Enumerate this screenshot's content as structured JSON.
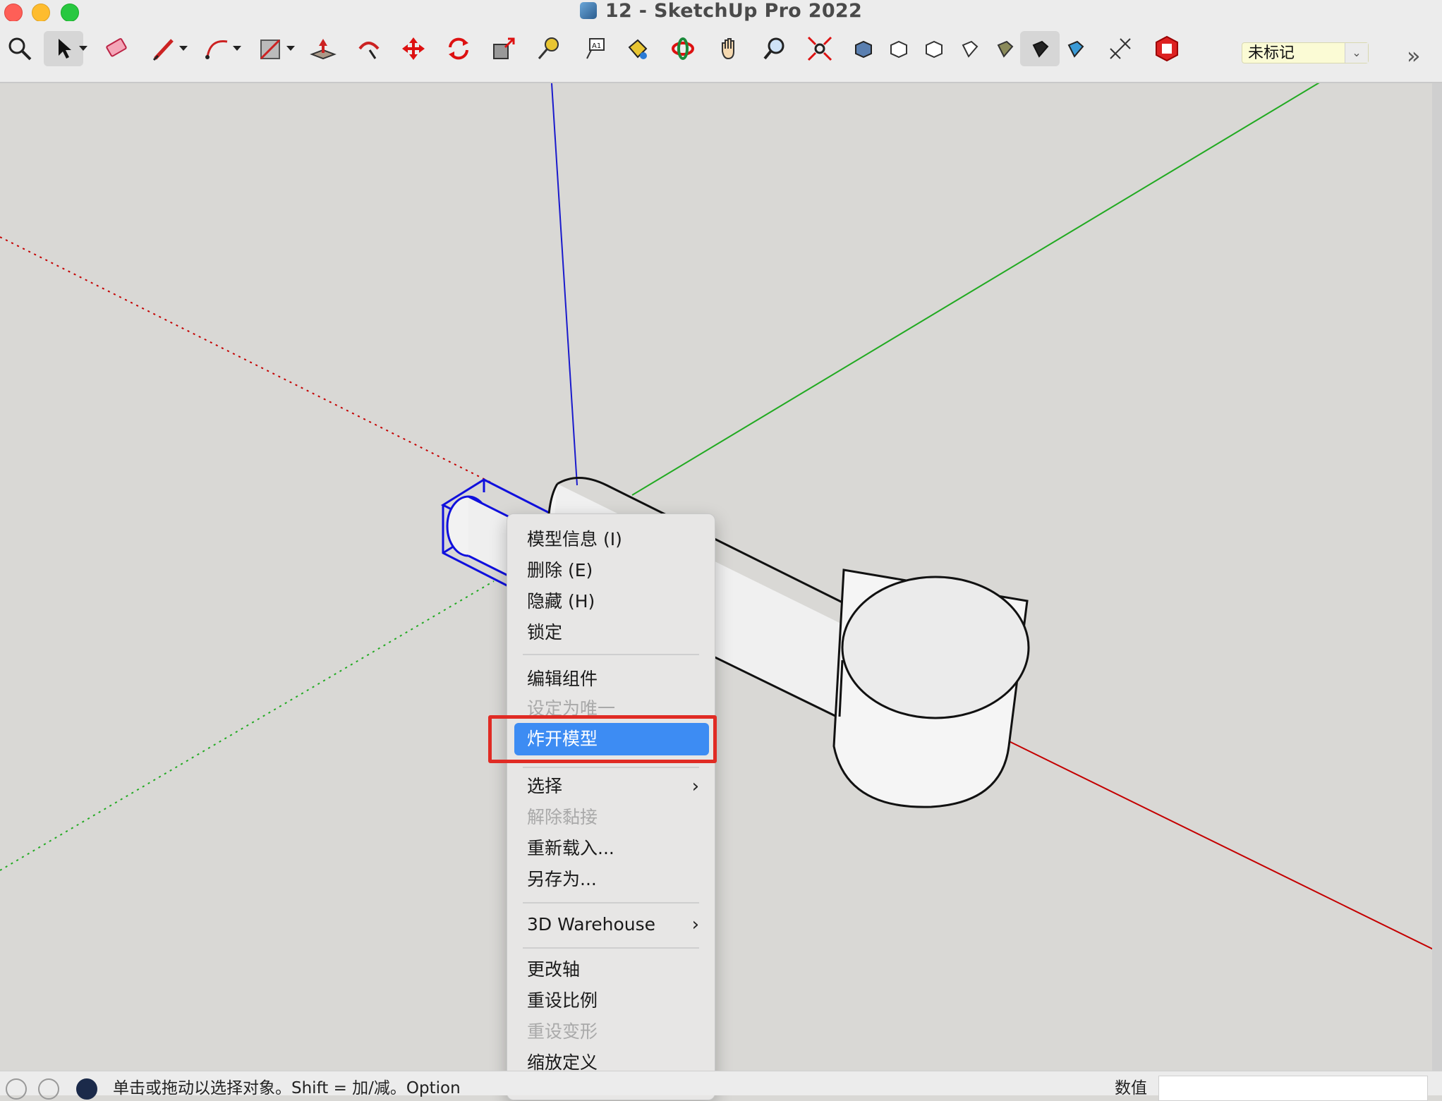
{
  "window": {
    "title": "12 - SketchUp Pro 2022"
  },
  "toolbar": {
    "tools": [
      "zoom-extents-icon",
      "select-icon",
      "eraser-icon",
      "pencil-icon",
      "arc-icon",
      "rectangle-icon",
      "push-pull-icon",
      "follow-me-icon",
      "move-icon",
      "rotate-icon",
      "scale-icon",
      "tape-measure-icon",
      "text-icon",
      "paint-bucket-icon",
      "orbit-icon",
      "pan-icon",
      "zoom-icon",
      "zoom-window-icon",
      "iso-view-icon",
      "top-view-icon",
      "front-view-icon",
      "right-view-icon",
      "back-view-icon",
      "left-view-icon",
      "bottom-view-icon",
      "section-plane-icon",
      "extension-warehouse-icon"
    ],
    "tag_value": "未标记",
    "more_label": "»"
  },
  "context_menu": {
    "items": [
      {
        "label": "模型信息 (I)",
        "enabled": true
      },
      {
        "label": "删除 (E)",
        "enabled": true
      },
      {
        "label": "隐藏 (H)",
        "enabled": true
      },
      {
        "label": "锁定",
        "enabled": true
      },
      {
        "label": "编辑组件",
        "enabled": true
      },
      {
        "label": "设定为唯一",
        "enabled": false
      },
      {
        "label": "炸开模型",
        "enabled": true,
        "highlighted": true
      },
      {
        "label": "选择",
        "enabled": true,
        "submenu": true
      },
      {
        "label": "解除黏接",
        "enabled": false
      },
      {
        "label": "重新载入...",
        "enabled": true
      },
      {
        "label": "另存为...",
        "enabled": true
      },
      {
        "label": "3D Warehouse",
        "enabled": true,
        "submenu": true
      },
      {
        "label": "更改轴",
        "enabled": true
      },
      {
        "label": "重设比例",
        "enabled": true
      },
      {
        "label": "重设变形",
        "enabled": false
      },
      {
        "label": "缩放定义",
        "enabled": true
      }
    ],
    "submenu_arrow": "›"
  },
  "status_bar": {
    "hint": "单击或拖动以选择对象。Shift = 加/减。Option",
    "value_label": "数值"
  },
  "colors": {
    "highlight": "#3d8cf3",
    "annotation": "#e02b24",
    "axis_red": "#c40000",
    "axis_green": "#22aa22",
    "axis_blue": "#1a1acc"
  }
}
